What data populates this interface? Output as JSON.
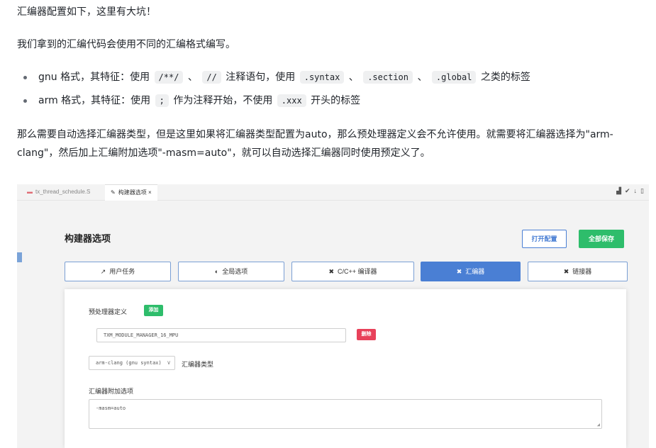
{
  "article": {
    "p1": "汇编器配置如下，这里有大坑！",
    "p2": "我们拿到的汇编代码会使用不同的汇编格式编写。",
    "bullets": [
      {
        "pre": "gnu 格式，其特征：使用",
        "code1": "/**/",
        "sep1": "、",
        "code2": "//",
        "mid": "注释语句，使用",
        "code3": ".syntax",
        "sep2": "、",
        "code4": ".section",
        "sep3": "、",
        "code5": ".global",
        "post": "之类的标签"
      },
      {
        "pre": "arm 格式，其特征：使用",
        "code1": ";",
        "mid": "作为注释开始，不使用",
        "code2": ".xxx",
        "post": "开头的标签"
      }
    ],
    "p3": "那么需要自动选择汇编器类型，但是这里如果将汇编器类型配置为auto，那么预处理器定义会不允许使用。就需要将汇编器选择为\"arm-clang\"，然后加上汇编附加选项\"-masm=auto\"，就可以自动选择汇编器同时使用预定义了。"
  },
  "screenshot": {
    "tabs": [
      {
        "label": "tx_thread_schedule.S",
        "icon": "asm-file-icon"
      },
      {
        "label": "构建器选项",
        "icon": "wrench-icon",
        "close": "×"
      }
    ],
    "right_icons": [
      "build-icon",
      "flash-icon",
      "download-icon",
      "panel-icon"
    ],
    "title": "构建器选项",
    "open_config": "打开配置",
    "save_all": "全部保存",
    "nav_tabs": [
      {
        "label": "用户任务",
        "icon": "↗"
      },
      {
        "label": "全局选项",
        "icon": "◐"
      },
      {
        "label": "C/C++ 编译器",
        "icon": "✖"
      },
      {
        "label": "汇编器",
        "icon": "✖"
      },
      {
        "label": "链接器",
        "icon": "✖"
      }
    ],
    "active_tab": 3,
    "preprocessor_label": "预处理器定义",
    "add_button": "添加",
    "define_value": "TXM_MODULE_MANAGER_16_MPU",
    "delete_button": "删除",
    "assembler_select": "arm-clang (gnu syntax)",
    "assembler_type_label": "汇编器类型",
    "extra_options_label": "汇编器附加选项",
    "extra_options_value": "-masm=auto",
    "colors": {
      "accent": "#4a7fd4",
      "save": "#2ebd6b",
      "delete": "#e8415a"
    }
  }
}
